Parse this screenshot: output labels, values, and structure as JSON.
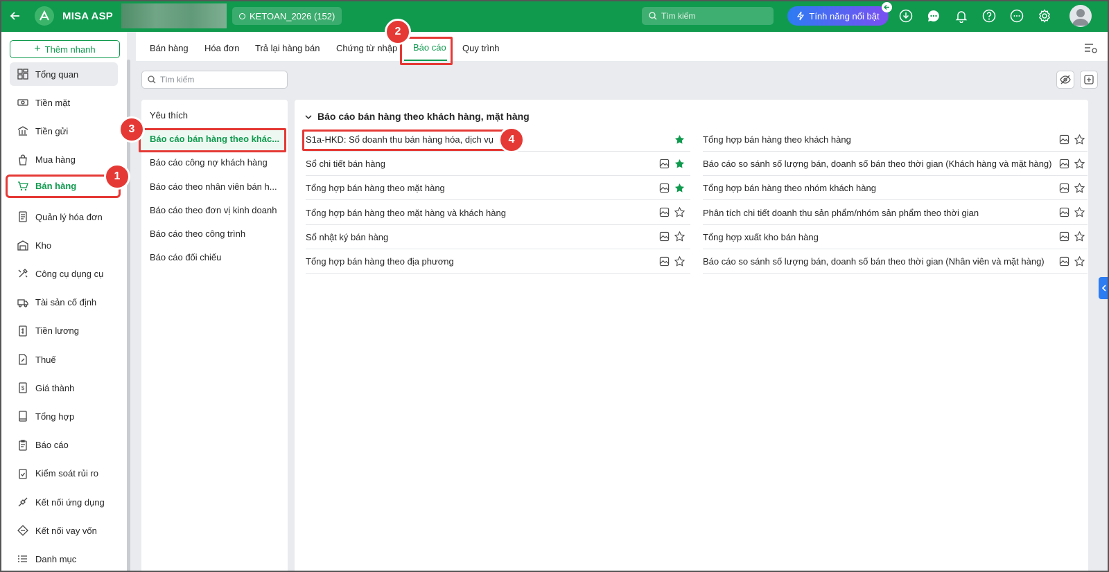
{
  "app": {
    "name": "MISA ASP",
    "database": "KETOAN_2026 (152)"
  },
  "topbar": {
    "search_placeholder": "Tìm kiếm",
    "feature_label": "Tính năng nổi bật",
    "icons": [
      "download-icon",
      "chat-icon",
      "bell-icon",
      "help-icon",
      "more-icon",
      "gear-icon"
    ]
  },
  "sidebar": {
    "quick_add": "Thêm nhanh",
    "items": [
      {
        "label": "Tổng quan",
        "icon": "dashboard-icon"
      },
      {
        "label": "Tiền mặt",
        "icon": "cash-icon"
      },
      {
        "label": "Tiền gửi",
        "icon": "bank-icon"
      },
      {
        "label": "Mua hàng",
        "icon": "bag-icon"
      },
      {
        "label": "Bán hàng",
        "icon": "cart-icon"
      },
      {
        "label": "Quản lý hóa đơn",
        "icon": "invoice-icon"
      },
      {
        "label": "Kho",
        "icon": "warehouse-icon"
      },
      {
        "label": "Công cụ dụng cụ",
        "icon": "tools-icon"
      },
      {
        "label": "Tài sản cố định",
        "icon": "truck-icon"
      },
      {
        "label": "Tiền lương",
        "icon": "salary-icon"
      },
      {
        "label": "Thuế",
        "icon": "tax-icon"
      },
      {
        "label": "Giá thành",
        "icon": "cost-icon"
      },
      {
        "label": "Tổng hợp",
        "icon": "book-icon"
      },
      {
        "label": "Báo cáo",
        "icon": "report-icon"
      },
      {
        "label": "Kiểm soát rủi ro",
        "icon": "risk-icon"
      },
      {
        "label": "Kết nối ứng dụng",
        "icon": "plug-icon"
      },
      {
        "label": "Kết nối vay vốn",
        "icon": "loan-icon"
      },
      {
        "label": "Danh mục",
        "icon": "list-icon"
      }
    ],
    "active_index": 4
  },
  "tabs": [
    {
      "label": "Bán hàng"
    },
    {
      "label": "Hóa đơn"
    },
    {
      "label": "Trả lại hàng bán"
    },
    {
      "label": "Chứng từ nhập"
    },
    {
      "label": "Báo cáo"
    },
    {
      "label": "Quy trình"
    }
  ],
  "content_search_placeholder": "Tìm kiếm",
  "categories": [
    {
      "label": "Yêu thích"
    },
    {
      "label": "Báo cáo bán hàng theo khác..."
    },
    {
      "label": "Báo cáo công nợ khách hàng"
    },
    {
      "label": "Báo cáo theo nhân viên bán h..."
    },
    {
      "label": "Báo cáo theo đơn vị kinh doanh"
    },
    {
      "label": "Báo cáo theo công trình"
    },
    {
      "label": "Báo cáo đối chiếu"
    }
  ],
  "report_group": {
    "title": "Báo cáo bán hàng theo khách hàng, mặt hàng",
    "left": [
      {
        "name": "S1a-HKD: Sổ doanh thu bán hàng hóa, dịch vụ",
        "starred": true,
        "has_preview": false
      },
      {
        "name": "Sổ chi tiết bán hàng",
        "starred": true,
        "has_preview": true
      },
      {
        "name": "Tổng hợp bán hàng theo mặt hàng",
        "starred": true,
        "has_preview": true
      },
      {
        "name": "Tổng hợp bán hàng theo mặt hàng và khách hàng",
        "starred": false,
        "has_preview": true
      },
      {
        "name": "Sổ nhật ký bán hàng",
        "starred": false,
        "has_preview": true
      },
      {
        "name": "Tổng hợp bán hàng theo địa phương",
        "starred": false,
        "has_preview": true
      }
    ],
    "right": [
      {
        "name": "Tổng hợp bán hàng theo khách hàng",
        "starred": false,
        "has_preview": true
      },
      {
        "name": "Báo cáo so sánh số lượng bán, doanh số bán theo thời gian (Khách hàng và mặt hàng)",
        "starred": false,
        "has_preview": true
      },
      {
        "name": "Tổng hợp bán hàng theo nhóm khách hàng",
        "starred": false,
        "has_preview": true
      },
      {
        "name": "Phân tích chi tiết doanh thu sản phẩm/nhóm sản phẩm theo thời gian",
        "starred": false,
        "has_preview": true
      },
      {
        "name": "Tổng hợp xuất kho bán hàng",
        "starred": false,
        "has_preview": true
      },
      {
        "name": "Báo cáo so sánh số lượng bán, doanh số bán theo thời gian (Nhân viên và mặt hàng)",
        "starred": false,
        "has_preview": true
      }
    ]
  },
  "step_badges": [
    "1",
    "2",
    "3",
    "4"
  ],
  "colors": {
    "brand": "#0f9a4e",
    "highlight": "#e53935",
    "star": "#0f9a4e"
  }
}
